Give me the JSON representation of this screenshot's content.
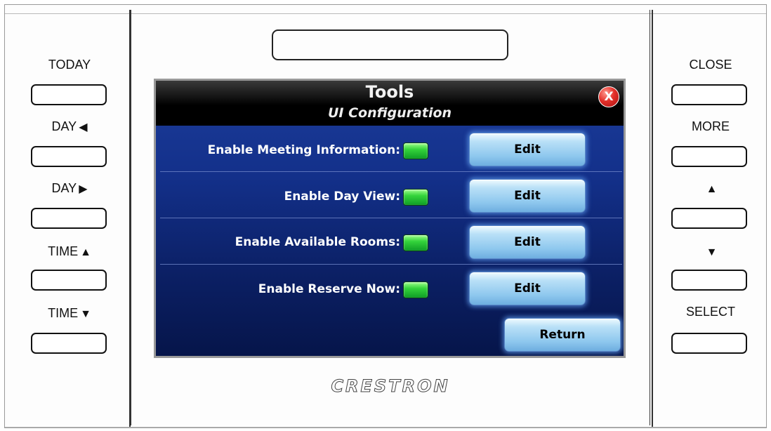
{
  "left_panel": {
    "labels": [
      {
        "text": "TODAY",
        "icon": ""
      },
      {
        "text": "DAY",
        "icon": "◀"
      },
      {
        "text": "DAY",
        "icon": "▶"
      },
      {
        "text": "TIME",
        "icon": "▲"
      },
      {
        "text": "TIME",
        "icon": "▼"
      }
    ]
  },
  "right_panel": {
    "labels": [
      {
        "text": "CLOSE",
        "icon": ""
      },
      {
        "text": "MORE",
        "icon": ""
      },
      {
        "text": "",
        "icon": "▲"
      },
      {
        "text": "",
        "icon": "▼"
      },
      {
        "text": "SELECT",
        "icon": ""
      }
    ]
  },
  "screen": {
    "title": "Tools",
    "subtitle": "UI Configuration",
    "close_icon": "X",
    "rows": [
      {
        "label": "Enable Meeting Information:",
        "enabled": true,
        "button": "Edit"
      },
      {
        "label": "Enable Day View:",
        "enabled": true,
        "button": "Edit"
      },
      {
        "label": "Enable Available Rooms:",
        "enabled": true,
        "button": "Edit"
      },
      {
        "label": "Enable Reserve Now:",
        "enabled": true,
        "button": "Edit"
      }
    ],
    "return_label": "Return",
    "led_color": "#34d43b",
    "button_color": "#8fc8ee",
    "background_color": "#13308a"
  },
  "brand": "CRESTRON"
}
